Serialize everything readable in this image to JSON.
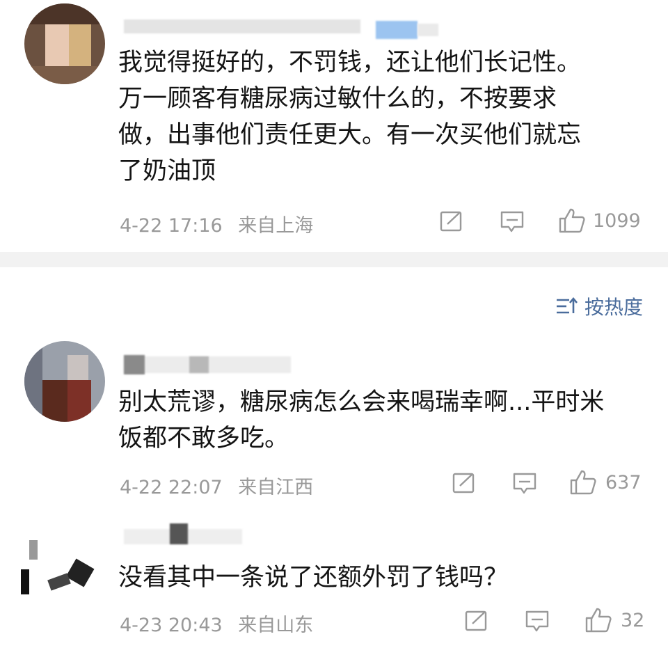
{
  "comments": [
    {
      "username": "",
      "text": "我觉得挺好的，不罚钱，还让他们长记性。\n万一顾客有糖尿病过敏什么的，不按要求\n做，出事他们责任更大。有一次买他们就忘\n了奶油顶",
      "time": "4-22 17:16",
      "location": "来自上海",
      "likes": "1099"
    },
    {
      "username": "",
      "text": "别太荒谬，糖尿病怎么会来喝瑞幸啊...平时米\n饭都不敢多吃。",
      "time": "4-22 22:07",
      "location": "来自江西",
      "likes": "637"
    },
    {
      "username": "",
      "text": "没看其中一条说了还额外罚了钱吗？",
      "time": "4-23 20:43",
      "location": "来自山东",
      "likes": "32"
    }
  ],
  "sort": {
    "label": "按热度"
  },
  "icons": [
    "share-icon",
    "comment-icon",
    "like-icon",
    "sort-icon"
  ],
  "colors": {
    "accent": "#4a6c9c",
    "meta": "#999999",
    "divider": "#f2f2f2"
  }
}
